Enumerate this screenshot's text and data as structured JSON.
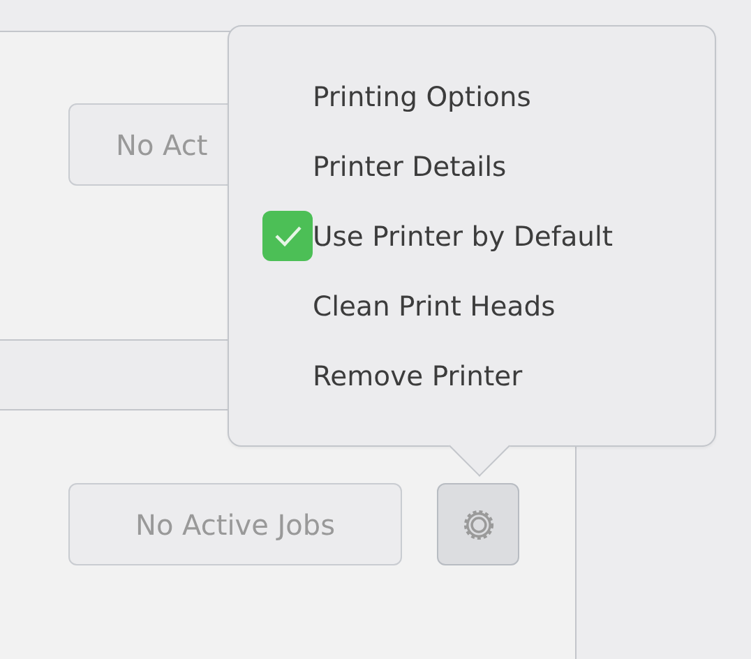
{
  "printers": [
    {
      "jobs_button": "No Act",
      "settings_button": false
    },
    {
      "jobs_button": "No Active Jobs",
      "settings_button": true
    }
  ],
  "popover": {
    "items": [
      {
        "label": "Printing Options",
        "kind": "action"
      },
      {
        "label": "Printer Details",
        "kind": "action"
      },
      {
        "label": "Use Printer by Default",
        "kind": "check",
        "checked": true
      },
      {
        "label": "Clean Print Heads",
        "kind": "action"
      },
      {
        "label": "Remove Printer",
        "kind": "action"
      }
    ]
  }
}
